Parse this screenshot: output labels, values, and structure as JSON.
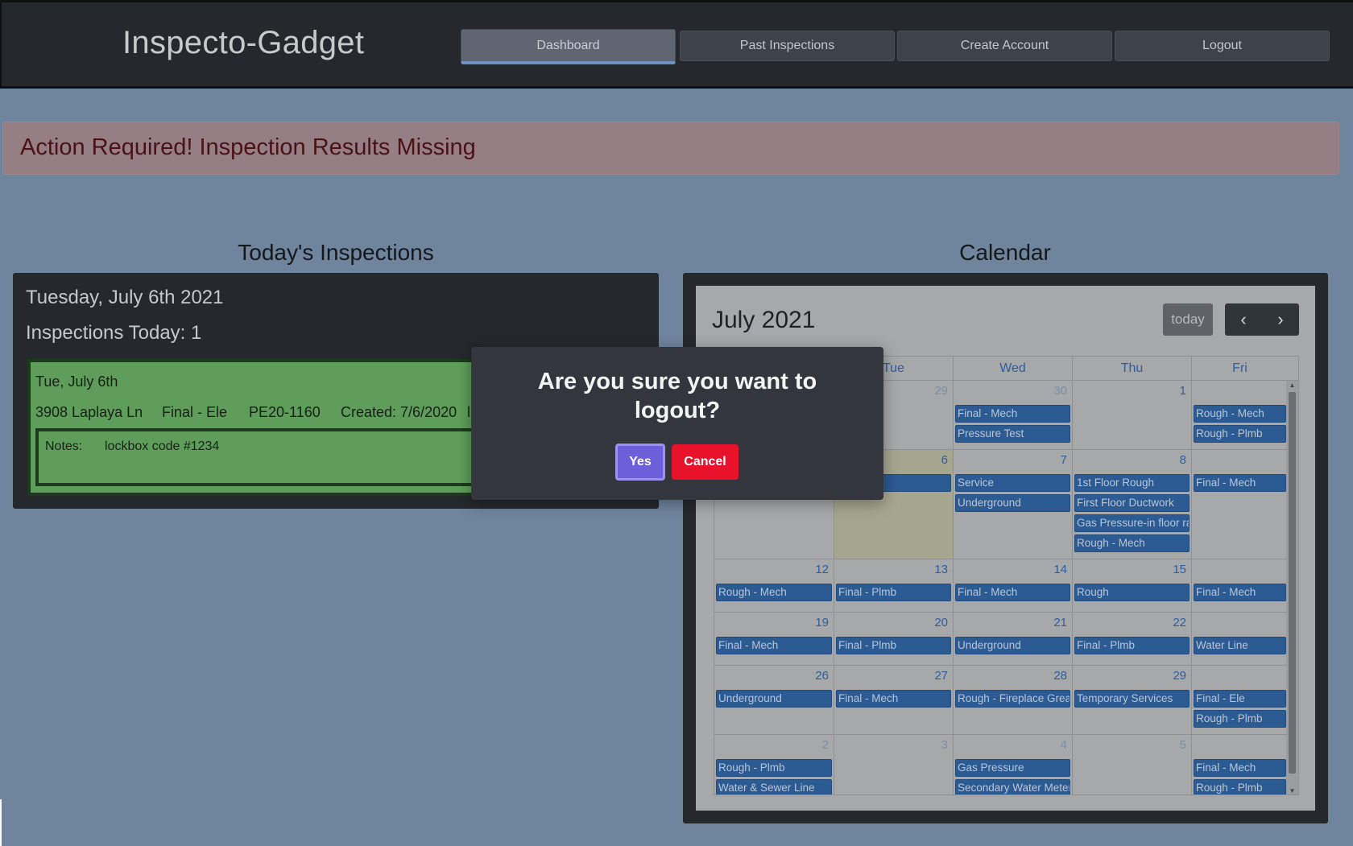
{
  "app": {
    "title": "Inspecto-Gadget",
    "nav": [
      {
        "label": "Dashboard",
        "active": true
      },
      {
        "label": "Past Inspections"
      },
      {
        "label": "Create Account"
      },
      {
        "label": "Logout"
      }
    ]
  },
  "alert": {
    "text": "Action Required! Inspection Results Missing"
  },
  "today": {
    "section_title": "Today's Inspections",
    "date": "Tuesday, July 6th 2021",
    "count_label": "Inspections Today: 1",
    "card": {
      "heading": "Tue, July 6th",
      "address": "3908 Laplaya Ln",
      "type": "Final - Ele",
      "permit": "PE20-1160",
      "created": "Created: 7/6/2020",
      "trailing": "l",
      "notes_label": "Notes:",
      "notes_value": "lockbox code #1234"
    }
  },
  "calendar": {
    "section_title": "Calendar",
    "month_title": "July 2021",
    "today_btn": "today",
    "prev_icon": "‹",
    "next_icon": "›",
    "headers": [
      "",
      "Tue",
      "Wed",
      "Thu",
      "Fri"
    ],
    "weeks": [
      {
        "days": [
          {
            "num": "",
            "other": true,
            "events": []
          },
          {
            "num": "29",
            "other": true,
            "events": []
          },
          {
            "num": "30",
            "other": true,
            "events": [
              "Final - Mech",
              "Pressure Test"
            ]
          },
          {
            "num": "1",
            "events": []
          },
          {
            "num": "",
            "events": [
              "Rough - Mech",
              "Rough - Plmb"
            ]
          }
        ]
      },
      {
        "days": [
          {
            "num": "",
            "events": []
          },
          {
            "num": "6",
            "today": true,
            "events": [
              ""
            ]
          },
          {
            "num": "7",
            "events": [
              "Service",
              "Underground"
            ]
          },
          {
            "num": "8",
            "events": [
              "1st Floor Rough",
              "First Floor Ductwork",
              "Gas Pressure-in floor radiant",
              "Rough - Mech"
            ]
          },
          {
            "num": "",
            "events": [
              "Final - Mech"
            ]
          }
        ]
      },
      {
        "days": [
          {
            "num": "12",
            "events": [
              "Rough - Mech"
            ]
          },
          {
            "num": "13",
            "events": [
              "Final - Plmb"
            ]
          },
          {
            "num": "14",
            "events": [
              "Final - Mech"
            ]
          },
          {
            "num": "15",
            "events": [
              "Rough"
            ]
          },
          {
            "num": "",
            "events": [
              "Final - Mech"
            ]
          }
        ]
      },
      {
        "days": [
          {
            "num": "19",
            "events": [
              "Final - Mech"
            ]
          },
          {
            "num": "20",
            "events": [
              "Final - Plmb"
            ]
          },
          {
            "num": "21",
            "events": [
              "Underground"
            ]
          },
          {
            "num": "22",
            "events": [
              "Final - Plmb"
            ]
          },
          {
            "num": "",
            "events": [
              "Water Line"
            ]
          }
        ]
      },
      {
        "days": [
          {
            "num": "26",
            "events": [
              "Underground"
            ]
          },
          {
            "num": "27",
            "events": [
              "Final - Mech"
            ]
          },
          {
            "num": "28",
            "events": [
              "Rough - Fireplace Grease Duct"
            ]
          },
          {
            "num": "29",
            "events": [
              "Temporary Services"
            ]
          },
          {
            "num": "",
            "events": [
              "Final - Ele",
              "Rough - Plmb"
            ]
          }
        ]
      },
      {
        "days": [
          {
            "num": "2",
            "other": true,
            "events": [
              "Rough - Plmb",
              "Water & Sewer Line"
            ]
          },
          {
            "num": "3",
            "other": true,
            "events": []
          },
          {
            "num": "4",
            "other": true,
            "events": [
              "Gas Pressure",
              "Secondary Water Meter"
            ]
          },
          {
            "num": "5",
            "other": true,
            "events": []
          },
          {
            "num": "",
            "events": [
              "Final - Mech",
              "Rough - Plmb"
            ]
          }
        ]
      }
    ]
  },
  "modal": {
    "title": "Are you sure you want to logout?",
    "yes_label": "Yes",
    "cancel_label": "Cancel"
  }
}
